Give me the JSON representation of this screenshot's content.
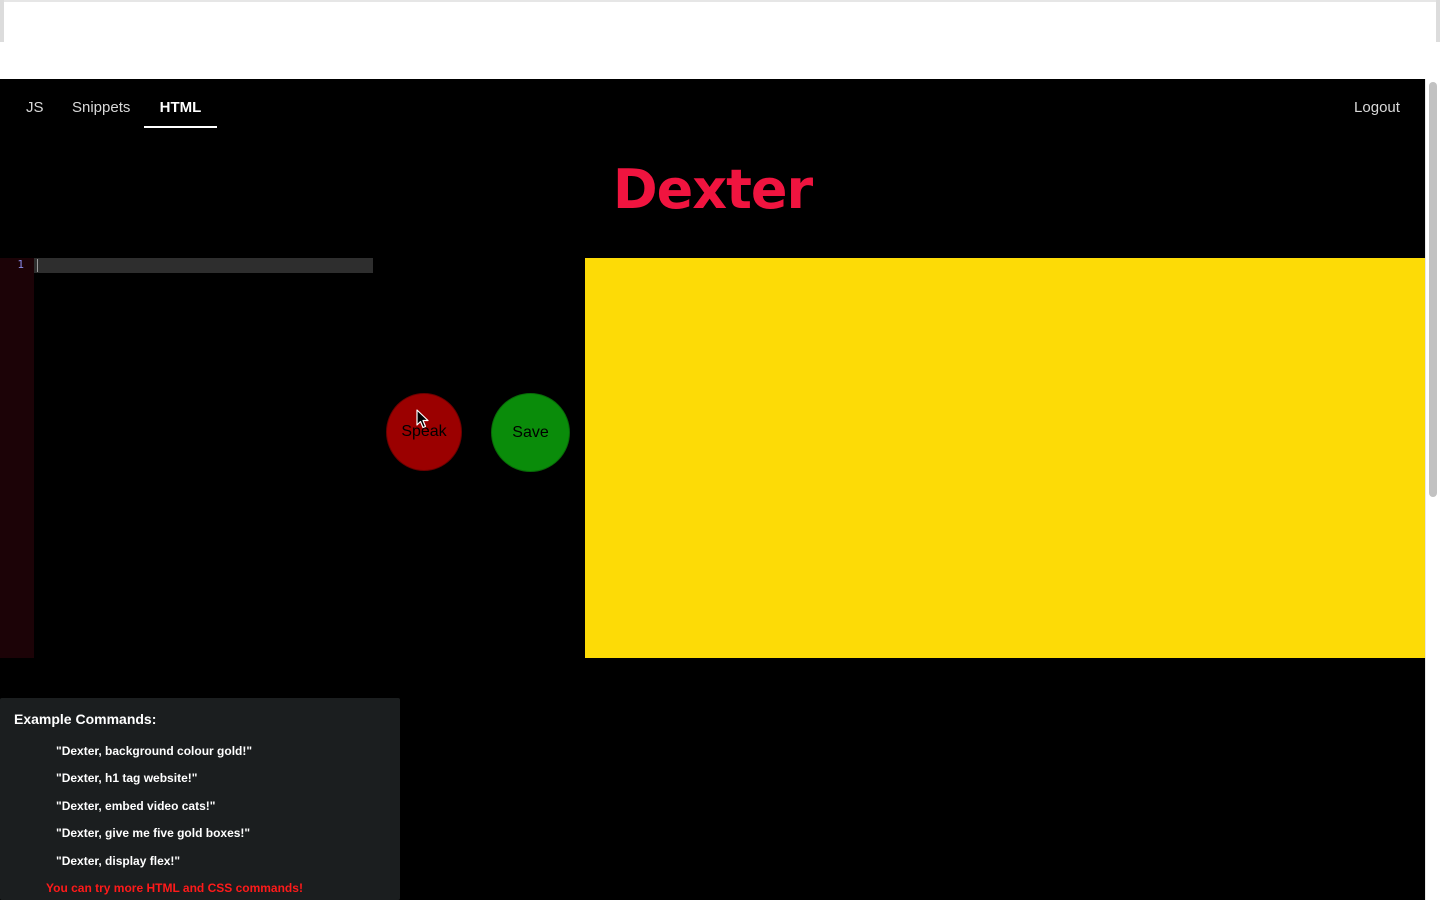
{
  "nav": {
    "tabs": [
      {
        "label": "JS",
        "active": false
      },
      {
        "label": "Snippets",
        "active": false
      },
      {
        "label": "HTML",
        "active": true
      }
    ],
    "logout_label": "Logout"
  },
  "header": {
    "title": "Dexter"
  },
  "editor": {
    "line_numbers": [
      "1"
    ],
    "content": ""
  },
  "buttons": {
    "speak_label": "Speak",
    "save_label": "Save"
  },
  "preview": {
    "background_color": "#fddb06"
  },
  "examples": {
    "heading": "Example Commands:",
    "items": [
      "\"Dexter, background colour gold!\"",
      "\"Dexter, h1 tag website!\"",
      "\"Dexter, embed video cats!\"",
      "\"Dexter, give me five gold boxes!\"",
      "\"Dexter, display flex!\""
    ],
    "note": "You can try more HTML and CSS commands!"
  },
  "colors": {
    "title": "#f0143f",
    "speak_button": "#9b0000",
    "save_button": "#0a8c0a",
    "note": "#ff1a1a"
  }
}
